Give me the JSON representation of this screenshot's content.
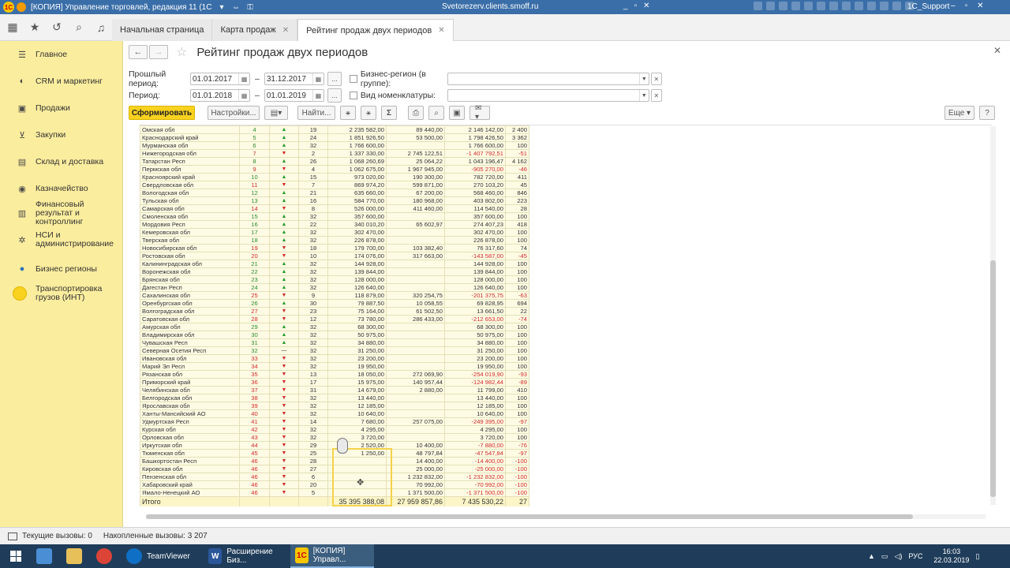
{
  "titlebar": {
    "logo": "1С",
    "title": "[КОПИЯ] Управление торговлей, редакция 11 (1С:Предприятие)",
    "host": "Svetorezerv.clients.smoff.ru",
    "user": "1C_Support",
    "minimize": "_",
    "restore": "▫",
    "close": "✕",
    "sys_minimize": "–",
    "sys_restore": "▫",
    "sys_close": "✕"
  },
  "tabs": [
    {
      "label": "Начальная страница",
      "closable": false
    },
    {
      "label": "Карта продаж",
      "closable": true
    },
    {
      "label": "Рейтинг продаж двух периодов",
      "closable": true
    }
  ],
  "sidebar": {
    "items": [
      {
        "label": "Главное",
        "icon": "menu-icon"
      },
      {
        "label": "CRM и маркетинг",
        "icon": "crm-icon"
      },
      {
        "label": "Продажи",
        "icon": "sales-icon"
      },
      {
        "label": "Закупки",
        "icon": "cart-icon"
      },
      {
        "label": "Склад и доставка",
        "icon": "warehouse-icon"
      },
      {
        "label": "Казначейство",
        "icon": "treasury-icon"
      },
      {
        "label": "Финансовый результат и контроллинг",
        "icon": "chart-icon"
      },
      {
        "label": "НСИ и администрирование",
        "icon": "gear-icon"
      },
      {
        "label": "Бизнес регионы",
        "icon": "globe-icon"
      },
      {
        "label": "Транспортировка грузов (ИНТ)",
        "icon": "circle-icon"
      }
    ]
  },
  "main": {
    "title": "Рейтинг продаж двух периодов",
    "prev_period_label": "Прошлый период:",
    "prev_from": "01.01.2017",
    "prev_to": "31.12.2017",
    "period_label": "Период:",
    "period_from": "01.01.2018",
    "period_to": "01.01.2019",
    "dash": "–",
    "dots": "...",
    "business_region_label": "Бизнес-регион (в группе):",
    "nomenclature_label": "Вид номенклатуры:",
    "generate_label": "Сформировать",
    "settings_label": "Настройки...",
    "find_label": "Найти...",
    "more_label": "Еще",
    "help_label": "?",
    "total_label": "Итого",
    "total_v1": "35 395 388,08",
    "total_v2": "27 959 857,86",
    "total_v3": "7 435 530,22",
    "total_v4": "27"
  },
  "report_rows": [
    [
      "Омская обл",
      "4",
      "up",
      "19",
      "2 235 582,00",
      "89 440,00",
      "2 146 142,00",
      "2 400"
    ],
    [
      "Краснодарский край",
      "5",
      "up",
      "24",
      "1 851 926,50",
      "53 500,00",
      "1 798 426,50",
      "3 362"
    ],
    [
      "Мурманская обл",
      "6",
      "up",
      "32",
      "1 766 600,00",
      "",
      "1 766 600,00",
      "100"
    ],
    [
      "Нижегородская обл",
      "7",
      "down",
      "2",
      "1 337 330,00",
      "2 745 122,51",
      "-1 407 792,51",
      "-51"
    ],
    [
      "Татарстан Респ",
      "8",
      "up",
      "26",
      "1 068 260,69",
      "25 064,22",
      "1 043 196,47",
      "4 162"
    ],
    [
      "Пермская обл",
      "9",
      "down",
      "4",
      "1 062 675,00",
      "1 967 945,00",
      "-905 270,00",
      "-46"
    ],
    [
      "Красноярский край",
      "10",
      "up",
      "15",
      "973 020,00",
      "190 300,00",
      "782 720,00",
      "411"
    ],
    [
      "Свердловская обл",
      "11",
      "down",
      "7",
      "869 974,20",
      "599 871,00",
      "270 103,20",
      "45"
    ],
    [
      "Вологодская обл",
      "12",
      "up",
      "21",
      "635 660,00",
      "67 200,00",
      "568 460,00",
      "846"
    ],
    [
      "Тульская обл",
      "13",
      "up",
      "16",
      "584 770,00",
      "180 968,00",
      "403 802,00",
      "223"
    ],
    [
      "Самарская обл",
      "14",
      "down",
      "8",
      "526 000,00",
      "411 460,00",
      "114 540,00",
      "28"
    ],
    [
      "Смоленская обл",
      "15",
      "up",
      "32",
      "357 600,00",
      "",
      "357 600,00",
      "100"
    ],
    [
      "Мордовия Респ",
      "16",
      "up",
      "22",
      "340 010,20",
      "65 602,97",
      "274 407,23",
      "418"
    ],
    [
      "Кемеровская обл",
      "17",
      "up",
      "32",
      "302 470,00",
      "",
      "302 470,00",
      "100"
    ],
    [
      "Тверская обл",
      "18",
      "up",
      "32",
      "226 878,00",
      "",
      "226 878,00",
      "100"
    ],
    [
      "Новосибирская обл",
      "19",
      "down",
      "18",
      "179 700,00",
      "103 382,40",
      "76 317,60",
      "74"
    ],
    [
      "Ростовская обл",
      "20",
      "down",
      "10",
      "174 076,00",
      "317 663,00",
      "-143 587,00",
      "-45"
    ],
    [
      "Калининградская обл",
      "21",
      "up",
      "32",
      "144 928,00",
      "",
      "144 928,00",
      "100"
    ],
    [
      "Воронежская обл",
      "22",
      "up",
      "32",
      "139 844,00",
      "",
      "139 844,00",
      "100"
    ],
    [
      "Брянская обл",
      "23",
      "up",
      "32",
      "128 000,00",
      "",
      "128 000,00",
      "100"
    ],
    [
      "Дагестан Респ",
      "24",
      "up",
      "32",
      "126 640,00",
      "",
      "126 640,00",
      "100"
    ],
    [
      "Сахалинская обл",
      "25",
      "down",
      "9",
      "118 879,00",
      "320 254,75",
      "-201 375,75",
      "-63"
    ],
    [
      "Оренбургская обл",
      "26",
      "up",
      "30",
      "79 887,50",
      "10 058,55",
      "69 828,95",
      "694"
    ],
    [
      "Волгоградская обл",
      "27",
      "down",
      "23",
      "75 164,00",
      "61 502,50",
      "13 661,50",
      "22"
    ],
    [
      "Саратовская обл",
      "28",
      "down",
      "12",
      "73 780,00",
      "286 433,00",
      "-212 653,00",
      "-74"
    ],
    [
      "Амурская обл",
      "29",
      "up",
      "32",
      "68 300,00",
      "",
      "68 300,00",
      "100"
    ],
    [
      "Владимирская обл",
      "30",
      "up",
      "32",
      "50 975,00",
      "",
      "50 975,00",
      "100"
    ],
    [
      "Чувашская Респ",
      "31",
      "up",
      "32",
      "34 880,00",
      "",
      "34 880,00",
      "100"
    ],
    [
      "Северная Осетия Респ",
      "32",
      "flat",
      "32",
      "31 250,00",
      "",
      "31 250,00",
      "100"
    ],
    [
      "Ивановская обл",
      "33",
      "down",
      "32",
      "23 200,00",
      "",
      "23 200,00",
      "100"
    ],
    [
      "Марий Эл Респ",
      "34",
      "down",
      "32",
      "19 950,00",
      "",
      "19 950,00",
      "100"
    ],
    [
      "Рязанская обл",
      "35",
      "down",
      "13",
      "18 050,00",
      "272 069,90",
      "-254 019,90",
      "-93"
    ],
    [
      "Приморский край",
      "36",
      "down",
      "17",
      "15 975,00",
      "140 957,44",
      "-124 982,44",
      "-89"
    ],
    [
      "Челябинская обл",
      "37",
      "down",
      "31",
      "14 679,00",
      "2 880,00",
      "11 799,00",
      "410"
    ],
    [
      "Белгородская обл",
      "38",
      "down",
      "32",
      "13 440,00",
      "",
      "13 440,00",
      "100"
    ],
    [
      "Ярославская обл",
      "39",
      "down",
      "32",
      "12 185,00",
      "",
      "12 185,00",
      "100"
    ],
    [
      "Ханты-Мансийский АО",
      "40",
      "down",
      "32",
      "10 640,00",
      "",
      "10 640,00",
      "100"
    ],
    [
      "Удмуртская Респ",
      "41",
      "down",
      "14",
      "7 680,00",
      "257 075,00",
      "-249 395,00",
      "-97"
    ],
    [
      "Курская обл",
      "42",
      "down",
      "32",
      "4 295,00",
      "",
      "4 295,00",
      "100"
    ],
    [
      "Орловская обл",
      "43",
      "down",
      "32",
      "3 720,00",
      "",
      "3 720,00",
      "100"
    ],
    [
      "Иркутская обл",
      "44",
      "down",
      "29",
      "2 520,00",
      "10 400,00",
      "-7 880,00",
      "-76"
    ],
    [
      "Тюменская обл",
      "45",
      "down",
      "25",
      "1 250,00",
      "48 797,84",
      "-47 547,84",
      "-97"
    ],
    [
      "Башкортостан Респ",
      "46",
      "down",
      "28",
      "",
      "14 400,00",
      "-14 400,00",
      "-100"
    ],
    [
      "Кировская обл",
      "46",
      "down",
      "27",
      "",
      "25 000,00",
      "-25 000,00",
      "-100"
    ],
    [
      "Пензенская обл",
      "46",
      "down",
      "6",
      "",
      "1 232 832,00",
      "-1 232 832,00",
      "-100"
    ],
    [
      "Хабаровский край",
      "46",
      "down",
      "20",
      "",
      "70 992,00",
      "-70 992,00",
      "-100"
    ],
    [
      "Ямало-Ненецкий АО",
      "46",
      "down",
      "5",
      "",
      "1 371 500,00",
      "-1 371 500,00",
      "-100"
    ]
  ],
  "statusbar": {
    "current_calls": "Текущие вызовы: 0",
    "accumulated_calls": "Накопленные вызовы: 3 207"
  },
  "taskbar": {
    "apps": [
      {
        "label": "TeamViewer"
      },
      {
        "label": "Расширение Биз..."
      },
      {
        "label": "[КОПИЯ] Управл..."
      }
    ],
    "lang": "РУС",
    "time": "16:03",
    "date": "22.03.2019"
  },
  "colors": {
    "accent_yellow": "#f8d21f",
    "sidebar_bg": "#fbed9e",
    "positive": "#2a9a2a",
    "negative": "#d12a2a",
    "titlebar": "#3a6ea8"
  }
}
